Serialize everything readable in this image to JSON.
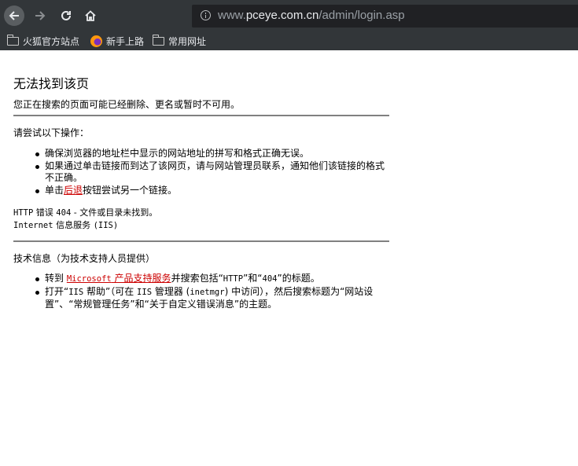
{
  "browser": {
    "url_prefix": "www.",
    "url_domain": "pceye.com.cn",
    "url_path": "/admin/login.asp",
    "bookmarks": [
      {
        "label": "火狐官方站点",
        "icon": "folder-icon"
      },
      {
        "label": "新手上路",
        "icon": "firefox-icon"
      },
      {
        "label": "常用网址",
        "icon": "folder-icon"
      }
    ]
  },
  "page": {
    "title": "无法找到该页",
    "subtitle": "您正在搜索的页面可能已经删除、更名或暂时不可用。",
    "try_heading": "请尝试以下操作：",
    "try_items": {
      "item1": "确保浏览器的地址栏中显示的网站地址的拼写和格式正确无误。",
      "item2": "如果通过单击链接而到达了该网页，请与网站管理员联系，通知他们该链接的格式不正确。",
      "item3_pre": "单击",
      "item3_link": "后退",
      "item3_post": "按钮尝试另一个链接。"
    },
    "error_line1_a": "HTTP",
    "error_line1_b": " 错误 ",
    "error_line1_c": "404",
    "error_line1_d": " - 文件或目录未找到。",
    "error_line2_a": "Internet",
    "error_line2_b": " 信息服务 ",
    "error_line2_c": "(IIS)",
    "tech_heading": "技术信息（为技术支持人员提供）",
    "tech_items": {
      "item1_pre": "转到 ",
      "item1_link_a": "Microsoft",
      "item1_link_b": " 产品支持服务",
      "item1_post_a": "并搜索包括“",
      "item1_post_b": "HTTP",
      "item1_post_c": "”和“",
      "item1_post_d": "404",
      "item1_post_e": "”的标题。",
      "item2_a": "打开“",
      "item2_b": "IIS",
      "item2_c": " 帮助”（可在 ",
      "item2_d": "IIS",
      "item2_e": " 管理器 (",
      "item2_f": "inetmgr",
      "item2_g": ") 中访问），然后搜索标题为“网站设置”、“常规管理任务”和“关于自定义错误消息”的主题。"
    }
  }
}
